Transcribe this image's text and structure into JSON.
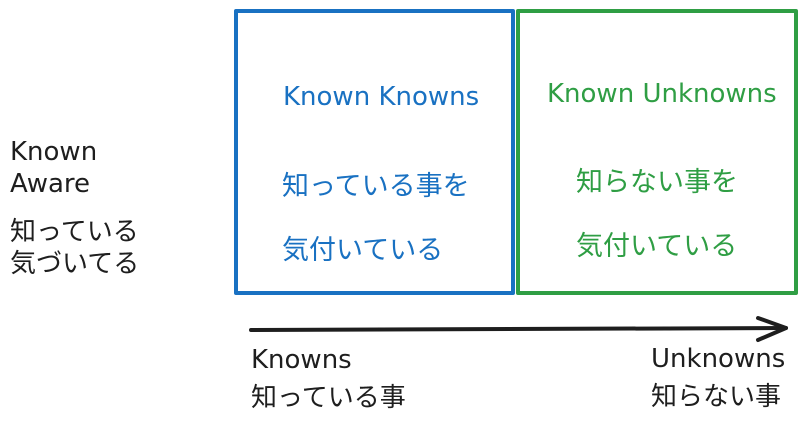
{
  "row_label": {
    "en_line1": "Known",
    "en_line2": "Aware",
    "ja_line1": "知っている",
    "ja_line2": "気づいてる"
  },
  "quadrants": [
    {
      "title": "Known Knowns",
      "subtitle_line1": "知っている事を",
      "subtitle_line2": "気付いている",
      "color": "#1971c2"
    },
    {
      "title": "Known Unknowns",
      "subtitle_line1": "知らない事を",
      "subtitle_line2": "気付いている",
      "color": "#2f9e44"
    }
  ],
  "axis": {
    "left_en": "Knowns",
    "left_ja": "知っている事",
    "right_en": "Unknowns",
    "right_ja": "知らない事",
    "arrow_color": "#1e1e1e"
  }
}
